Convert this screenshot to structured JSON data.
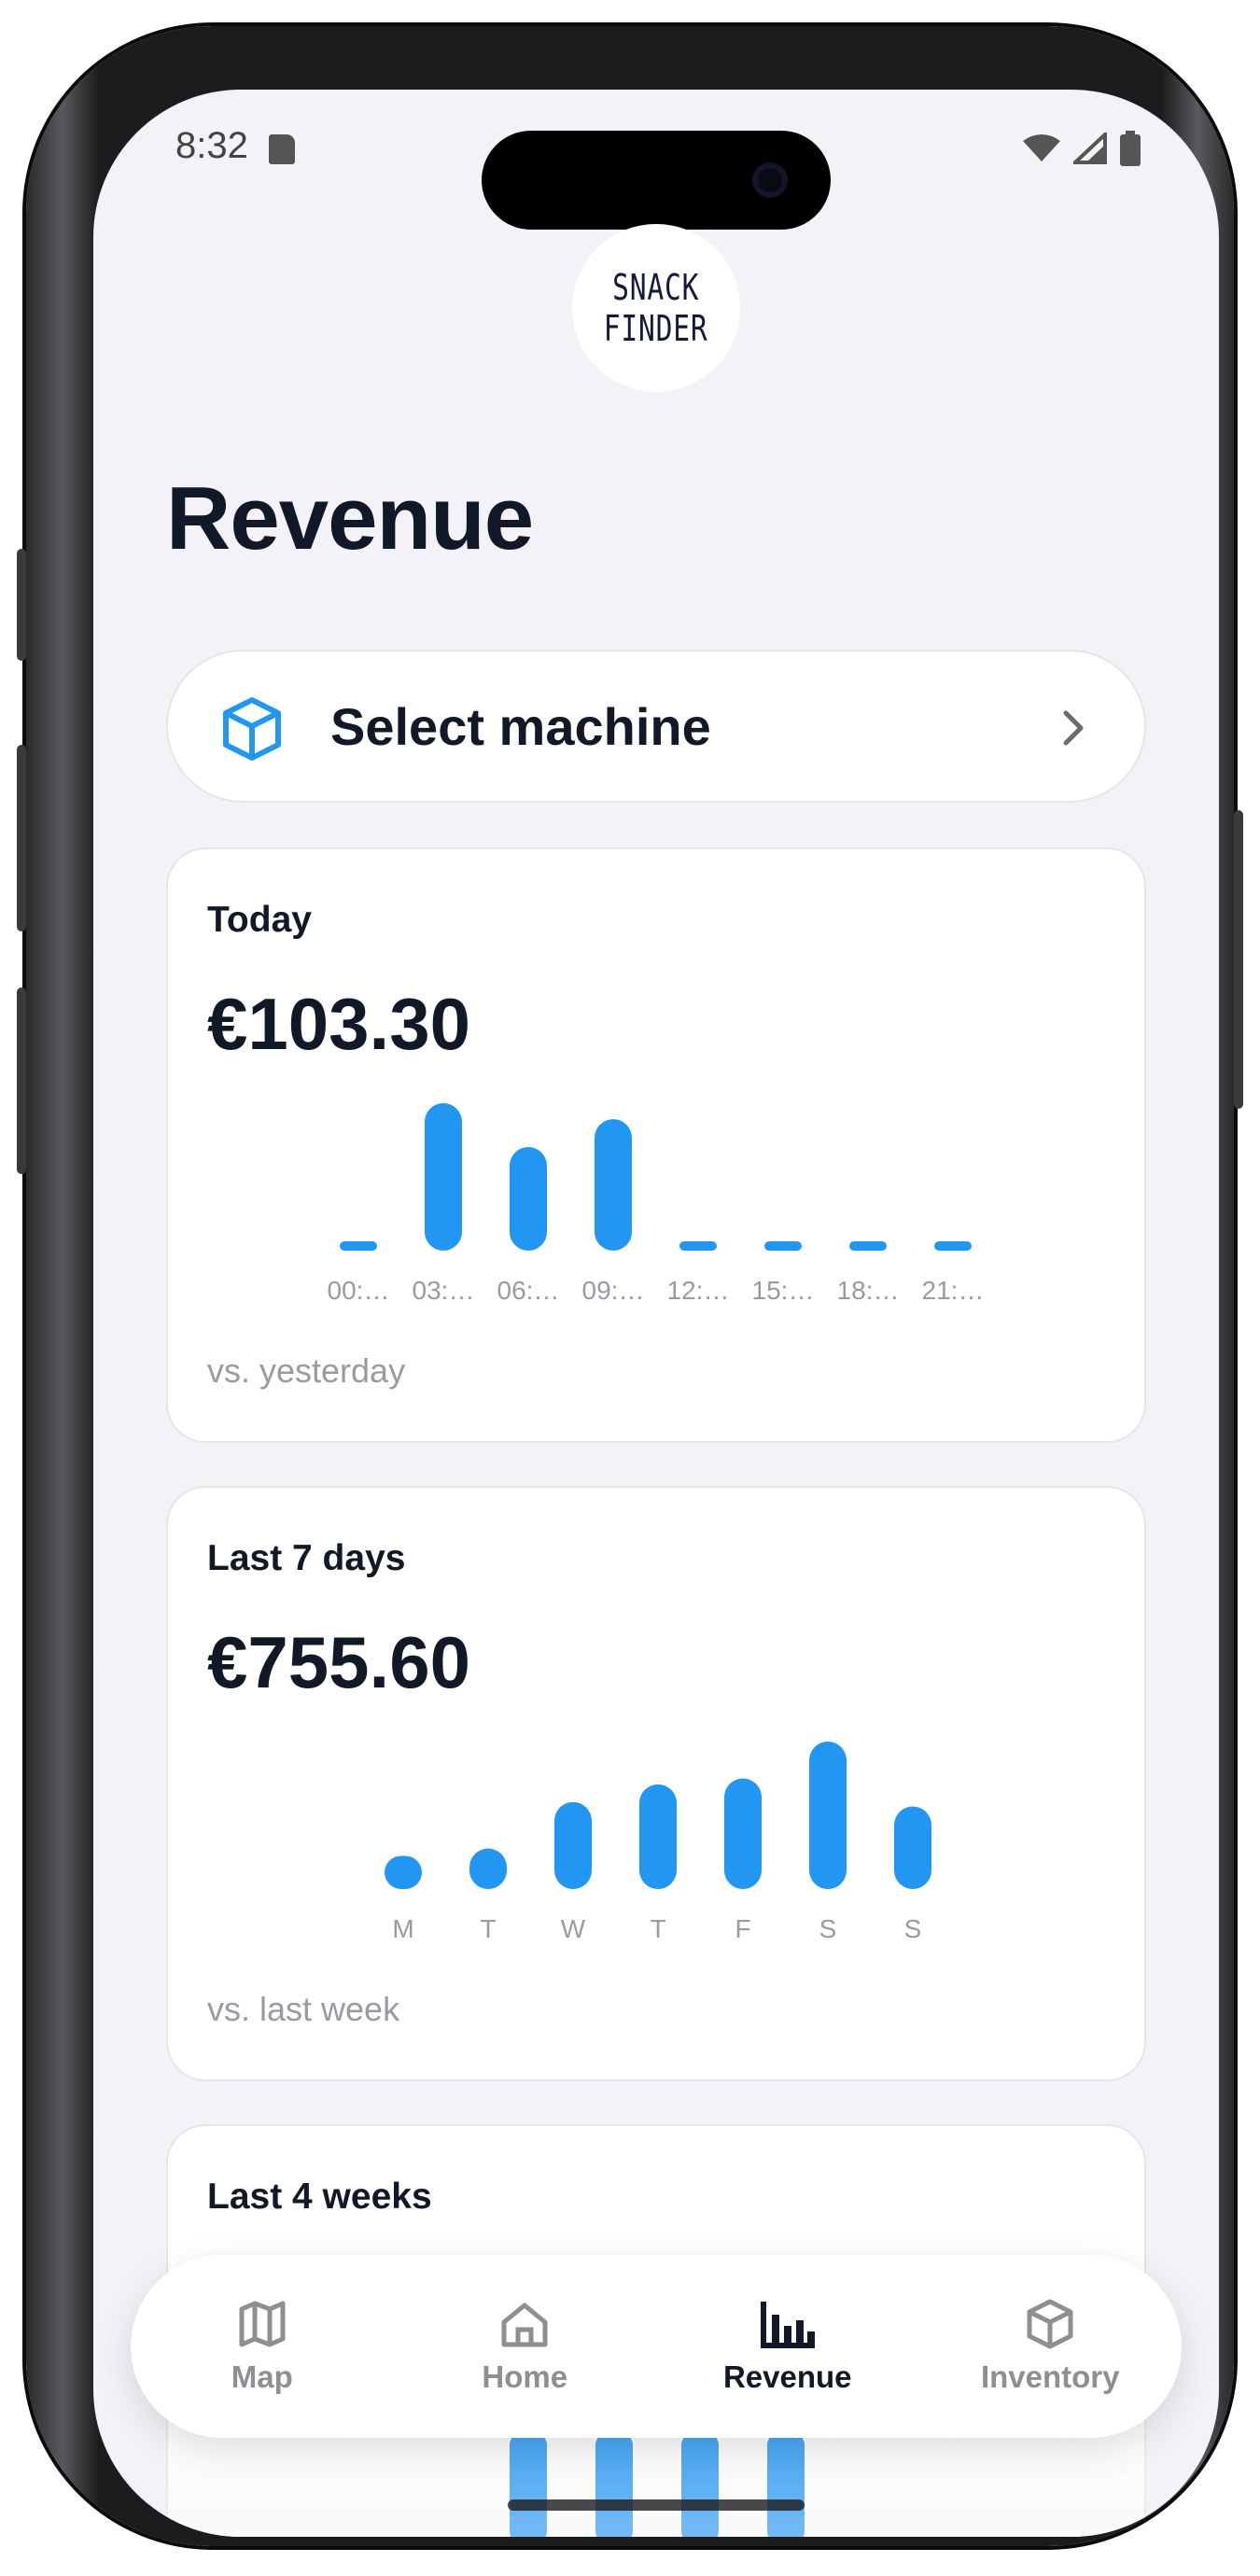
{
  "status_bar": {
    "time": "8:32"
  },
  "logo": {
    "line1": "SNACK",
    "line2": "FINDER"
  },
  "page": {
    "title": "Revenue"
  },
  "machine_selector": {
    "label": "Select machine",
    "icon": "cube-icon"
  },
  "cards": [
    {
      "title": "Today",
      "amount": "€103.30",
      "comparison": "vs. yesterday"
    },
    {
      "title": "Last 7 days",
      "amount": "€755.60",
      "comparison": "vs. last week"
    },
    {
      "title": "Last 4 weeks"
    }
  ],
  "tabbar": {
    "items": [
      {
        "label": "Map",
        "icon": "map-icon",
        "active": false
      },
      {
        "label": "Home",
        "icon": "home-icon",
        "active": false
      },
      {
        "label": "Revenue",
        "icon": "bar-chart-icon",
        "active": true
      },
      {
        "label": "Inventory",
        "icon": "box-icon",
        "active": false
      }
    ]
  },
  "colors": {
    "accent": "#2196F3",
    "text": "#111827",
    "muted": "#9a9aa2",
    "background": "#f2f2f7"
  },
  "chart_data": [
    {
      "type": "bar",
      "title": "Today",
      "categories": [
        "00:…",
        "03:…",
        "06:…",
        "09:…",
        "12:…",
        "15:…",
        "18:…",
        "21:…"
      ],
      "values": [
        0,
        37,
        26,
        33,
        0,
        0,
        0,
        0
      ],
      "ylim": [
        0,
        37
      ]
    },
    {
      "type": "bar",
      "title": "Last 7 days",
      "categories": [
        "M",
        "T",
        "W",
        "T",
        "F",
        "S",
        "S"
      ],
      "values": [
        45,
        55,
        118,
        142,
        150,
        200,
        112
      ],
      "ylim": [
        0,
        200
      ]
    }
  ]
}
